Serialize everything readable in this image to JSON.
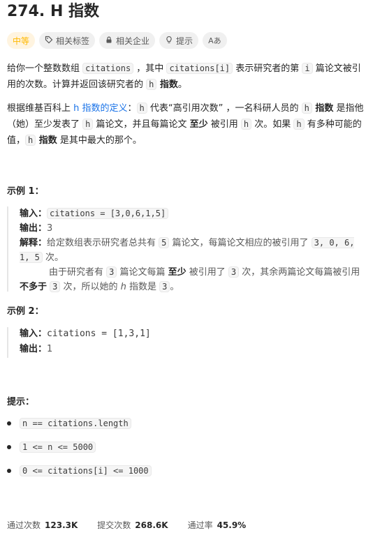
{
  "title": "274. H 指数",
  "tags": {
    "difficulty": "中等",
    "related_tags": "相关标签",
    "related_companies": "相关企业",
    "hint": "提示",
    "font_icon_label": "Aあ"
  },
  "desc1": {
    "t1": "给你一个整数数组 ",
    "c1": "citations",
    "t2": " ，其中 ",
    "c2": "citations[i]",
    "t3": " 表示研究者的第 ",
    "c3": "i",
    "t4": " 篇论文被引用的次数。计算并返回该研究者的 ",
    "c4": "h",
    "b1": " 指数",
    "t5": "。"
  },
  "desc2": {
    "t1": "根据维基百科上 ",
    "link": "h 指数的定义",
    "t2": "：",
    "c1": "h",
    "t3": " 代表“高引用次数” ，一名科研人员的 ",
    "c2": "h",
    "b1": " 指数",
    "t4": " 是指他（她）至少发表了 ",
    "c3": "h",
    "t5": " 篇论文，并且每篇论文 ",
    "b2": "至少",
    "t6": " 被引用 ",
    "c4": "h",
    "t7": " 次。如果 ",
    "c5": "h",
    "t8": " 有多种可能的值，",
    "c6": "h",
    "b3": " 指数",
    "t9": " 是其中最大的那个。"
  },
  "example1": {
    "title": "示例 1：",
    "input_label": "输入：",
    "input_value": "citations = [3,0,6,1,5]",
    "output_label": "输出：",
    "output_value": "3",
    "explain_label": "解释：",
    "e1": "给定数组表示研究者总共有 ",
    "c1": "5",
    "e2": " 篇论文，每篇论文相应的被引用了 ",
    "c2": "3, 0, 6, 1, 5",
    "e3": " 次。",
    "e4": "由于研究者有 ",
    "c3": "3",
    "e5": " 篇论文每篇 ",
    "b1": "至少",
    "e6": " 被引用了 ",
    "c4": "3",
    "e7": " 次，其余两篇论文每篇被引用 ",
    "b2": "不多于",
    "e8": " ",
    "c5": "3",
    "e9": " 次，所以她的 ",
    "i1": "h",
    "e10": " 指数是 ",
    "c6": "3",
    "e11": "。"
  },
  "example2": {
    "title": "示例 2：",
    "input_label": "输入：",
    "input_value": "citations = [1,3,1]",
    "output_label": "输出：",
    "output_value": "1"
  },
  "hints": {
    "title": "提示：",
    "items": [
      "n == citations.length",
      "1 <= n <= 5000",
      "0 <= citations[i] <= 1000"
    ]
  },
  "stats": {
    "passed_label": "通过次数",
    "passed_value": "123.3K",
    "submitted_label": "提交次数",
    "submitted_value": "268.6K",
    "rate_label": "通过率",
    "rate_value": "45.9%"
  }
}
